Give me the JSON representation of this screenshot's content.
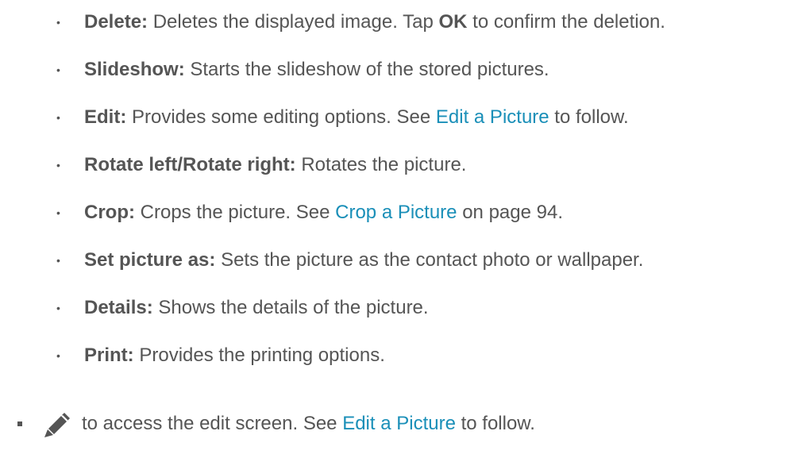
{
  "items": [
    {
      "label": "Delete:",
      "parts": [
        "Deletes the displayed image. Tap ",
        "OK",
        " to confirm the deletion."
      ]
    },
    {
      "label": "Slideshow:",
      "parts": [
        "Starts the slideshow of the stored pictures."
      ]
    },
    {
      "label": "Edit:",
      "parts": [
        "Provides some editing options. See ",
        "Edit a Picture",
        " to follow."
      ]
    },
    {
      "label": "Rotate left/Rotate right:",
      "parts": [
        "Rotates the picture."
      ]
    },
    {
      "label": "Crop:",
      "parts": [
        "Crops the picture. See ",
        "Crop a Picture",
        " on page 94."
      ]
    },
    {
      "label": "Set picture as:",
      "parts": [
        "Sets the picture as the contact photo or wallpaper."
      ]
    },
    {
      "label": "Details:",
      "parts": [
        "Shows the details of the picture."
      ]
    },
    {
      "label": "Print:",
      "parts": [
        "Provides the printing options."
      ]
    }
  ],
  "bullet": "•",
  "last": {
    "icon": "pencil-icon",
    "parts": [
      "to access the edit screen. See ",
      "Edit a Picture",
      " to follow."
    ]
  },
  "colors": {
    "text": "#555555",
    "link": "#1a8fb8"
  }
}
